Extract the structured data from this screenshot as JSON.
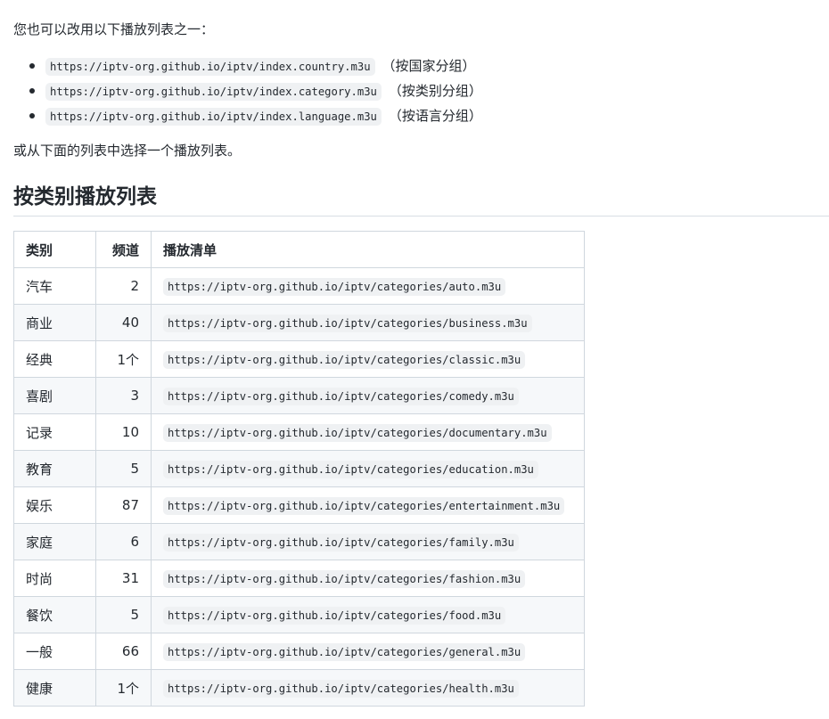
{
  "intro_text": "您也可以改用以下播放列表之一：",
  "lists": [
    {
      "url": "https://iptv-org.github.io/iptv/index.country.m3u",
      "note": "（按国家分组）"
    },
    {
      "url": "https://iptv-org.github.io/iptv/index.category.m3u",
      "note": "（按类别分组）"
    },
    {
      "url": "https://iptv-org.github.io/iptv/index.language.m3u",
      "note": "（按语言分组）"
    }
  ],
  "outro_text": "或从下面的列表中选择一个播放列表。",
  "section_title": "按类别播放列表",
  "table": {
    "headers": [
      "类别",
      "频道",
      "播放清单"
    ],
    "rows": [
      {
        "category": "汽车",
        "channels": "2",
        "playlist": "https://iptv-org.github.io/iptv/categories/auto.m3u"
      },
      {
        "category": "商业",
        "channels": "40",
        "playlist": "https://iptv-org.github.io/iptv/categories/business.m3u"
      },
      {
        "category": "经典",
        "channels": "1个",
        "playlist": "https://iptv-org.github.io/iptv/categories/classic.m3u"
      },
      {
        "category": "喜剧",
        "channels": "3",
        "playlist": "https://iptv-org.github.io/iptv/categories/comedy.m3u"
      },
      {
        "category": "记录",
        "channels": "10",
        "playlist": "https://iptv-org.github.io/iptv/categories/documentary.m3u"
      },
      {
        "category": "教育",
        "channels": "5",
        "playlist": "https://iptv-org.github.io/iptv/categories/education.m3u"
      },
      {
        "category": "娱乐",
        "channels": "87",
        "playlist": "https://iptv-org.github.io/iptv/categories/entertainment.m3u"
      },
      {
        "category": "家庭",
        "channels": "6",
        "playlist": "https://iptv-org.github.io/iptv/categories/family.m3u"
      },
      {
        "category": "时尚",
        "channels": "31",
        "playlist": "https://iptv-org.github.io/iptv/categories/fashion.m3u"
      },
      {
        "category": "餐饮",
        "channels": "5",
        "playlist": "https://iptv-org.github.io/iptv/categories/food.m3u"
      },
      {
        "category": "一般",
        "channels": "66",
        "playlist": "https://iptv-org.github.io/iptv/categories/general.m3u"
      },
      {
        "category": "健康",
        "channels": "1个",
        "playlist": "https://iptv-org.github.io/iptv/categories/health.m3u"
      }
    ]
  }
}
